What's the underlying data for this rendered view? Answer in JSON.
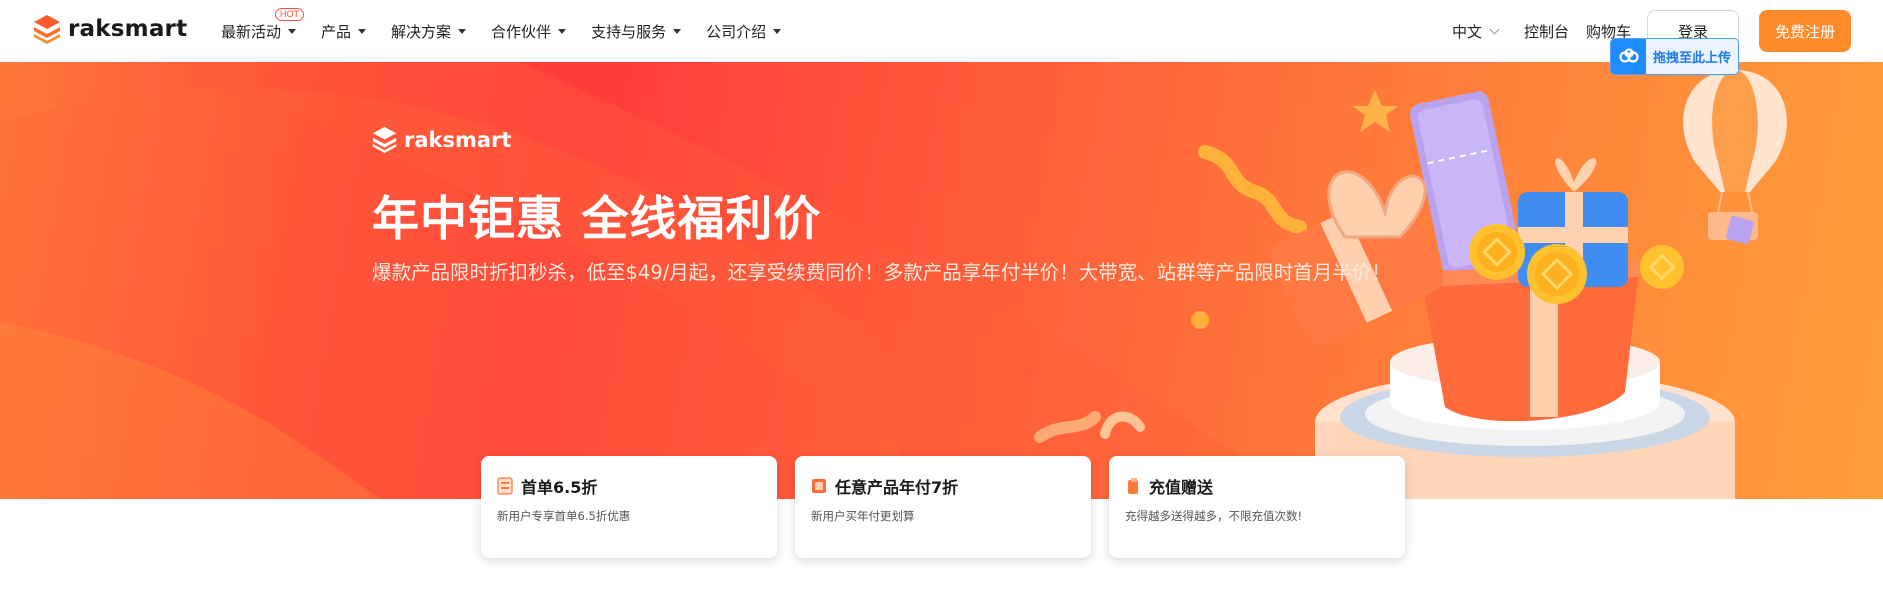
{
  "nav": {
    "brand": "raksmart",
    "menu": [
      {
        "label": "最新活动",
        "badge": "HOT"
      },
      {
        "label": "产品"
      },
      {
        "label": "解决方案"
      },
      {
        "label": "合作伙伴"
      },
      {
        "label": "支持与服务"
      },
      {
        "label": "公司介绍"
      }
    ],
    "language": "中文",
    "console": "控制台",
    "cart": "购物车",
    "login": "登录",
    "register": "免费注册",
    "upload_hint": "拖拽至此上传"
  },
  "banner": {
    "brand": "raksmart",
    "title": "年中钜惠 全线福利价",
    "subtitle": "爆款产品限时折扣秒杀，低至$49/月起，还享受续费同价！多款产品享年付半价！大带宽、站群等产品限时首月半价！"
  },
  "cards": [
    {
      "title": "首单6.5折",
      "desc": "新用户专享首单6.5折优惠",
      "icon": "coupon-icon"
    },
    {
      "title": "任意产品年付7折",
      "desc": "新用户买年付更划算",
      "icon": "gift-card-icon"
    },
    {
      "title": "充值赠送",
      "desc": "充得越多送得越多，不限充值次数!",
      "icon": "wallet-icon"
    }
  ],
  "colors": {
    "accent": "#ff8a2b",
    "hot_badge": "#ff4d3b",
    "banner_red": "#ff3b3c",
    "banner_orange": "#ff9f3a",
    "upload_blue": "#1e8bff"
  }
}
